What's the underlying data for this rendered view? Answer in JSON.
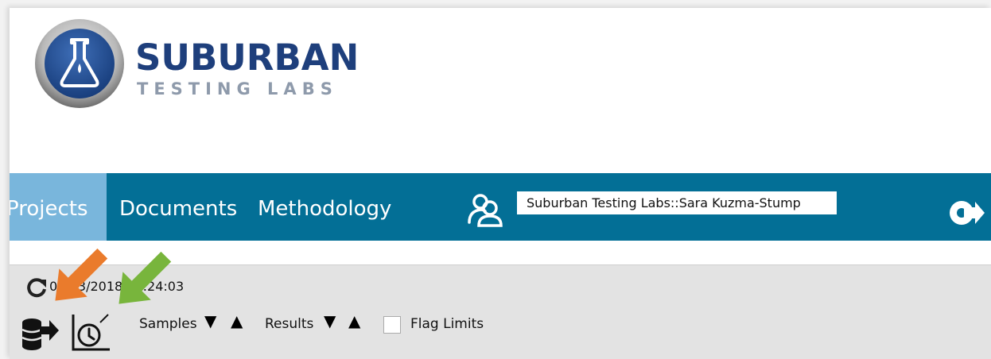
{
  "brand": {
    "name": "SUBURBAN",
    "tagline": "TESTING LABS",
    "logo_icon": "flask-icon",
    "colors": {
      "primary": "#1e3f7c",
      "secondary": "#8e9aab"
    }
  },
  "nav": {
    "items": [
      {
        "label": "Projects",
        "active": true
      },
      {
        "label": "Documents",
        "active": false
      },
      {
        "label": "Methodology",
        "active": false
      }
    ],
    "users_icon": "users-icon",
    "current_user": "Suburban Testing Labs::Sara Kuzma-Stump",
    "logout_icon": "logout-icon",
    "colors": {
      "bar": "#036f96",
      "active": "#79b6dc"
    }
  },
  "toolbar": {
    "refresh_icon": "refresh-icon",
    "timestamp": "04/03/2018 10:24:03",
    "export_icon": "database-export-icon",
    "chart_icon": "time-chart-icon",
    "samples_label": "Samples",
    "results_label": "Results",
    "sort_down": "▼",
    "sort_up": "▲",
    "flag_limits_label": "Flag Limits",
    "flag_limits_checked": false
  },
  "annotations": {
    "orange_arrow": "#ea7b2c",
    "green_arrow": "#78b53c"
  }
}
